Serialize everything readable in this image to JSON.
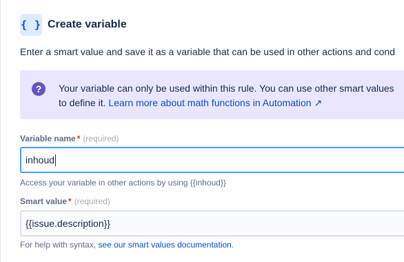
{
  "header": {
    "icon_glyph": "{ }",
    "title": "Create variable"
  },
  "description": "Enter a smart value and save it as a variable that can be used in other actions and cond",
  "info": {
    "icon": "question-icon",
    "icon_glyph": "?",
    "line1": "Your variable can only be used within this rule. You can use other smart values",
    "line2_prefix": "to define it. ",
    "link_text": "Learn more about math functions in Automation ↗"
  },
  "variable_name": {
    "label": "Variable name",
    "required_star": "*",
    "required_text": "(required)",
    "value": "inhoud",
    "helper": "Access your variable in other actions by using {{inhoud}}"
  },
  "smart_value": {
    "label": "Smart value",
    "required_star": "*",
    "required_text": "(required)",
    "value": "{{issue.description}}",
    "helper_prefix": "For help with syntax, ",
    "helper_link": "see our smart values documentation",
    "helper_suffix": "."
  },
  "colors": {
    "accent": "#0052cc",
    "info_bg": "#eae6ff",
    "info_icon": "#6554c0",
    "focus_border": "#4c9aff",
    "required": "#de350b"
  }
}
